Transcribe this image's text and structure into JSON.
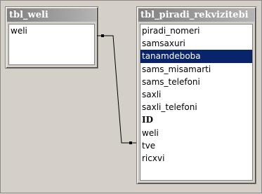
{
  "tables": [
    {
      "title": "tbl_weli",
      "fields": [
        "weli"
      ]
    },
    {
      "title": "tbl_piradi_rekvizitebi",
      "fields": [
        "piradi_nomeri",
        "samsaxuri",
        "tanamdeboba",
        "sams_misamarti",
        "sams_telefoni",
        "saxli",
        "saxli_telefoni",
        "ID",
        "weli",
        "tve",
        "ricxvi"
      ],
      "selected_field": "tanamdeboba",
      "key_field": "ID"
    }
  ],
  "relationship": {
    "from": "tbl_weli.weli",
    "to": "tbl_piradi_rekvizitebi.weli",
    "color": "#000000"
  },
  "colors": {
    "background": "#d4d0c8",
    "title_bar": "#808080",
    "selection": "#0a246a"
  }
}
